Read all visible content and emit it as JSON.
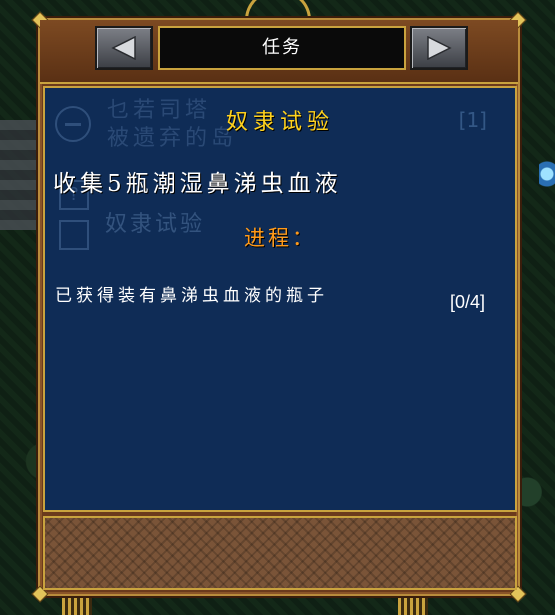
{
  "window": {
    "title": "任务"
  },
  "navigation": {
    "prev_icon": "triangle-left-icon",
    "next_icon": "triangle-right-icon"
  },
  "quest": {
    "name": "奴隶试验",
    "objective": "收集5瓶潮湿鼻涕虫血液",
    "progress_label": "进程：",
    "progress_item": "已获得装有鼻涕虫血液的瓶子",
    "progress_count": "[0/4]",
    "progress_current": 0,
    "progress_total": 4
  },
  "background_list": {
    "entry1_line1": "乜若司塔",
    "entry1_line2": "被遗弃的岛",
    "entry1_count": "[1]",
    "entry2": "奴隶试验"
  },
  "colors": {
    "quest_name": "#ffd21e",
    "progress_label": "#ff9a1a",
    "panel_blue": "#0f2c56",
    "frame_gold": "#c9a33e",
    "leather": "#7a5438"
  }
}
